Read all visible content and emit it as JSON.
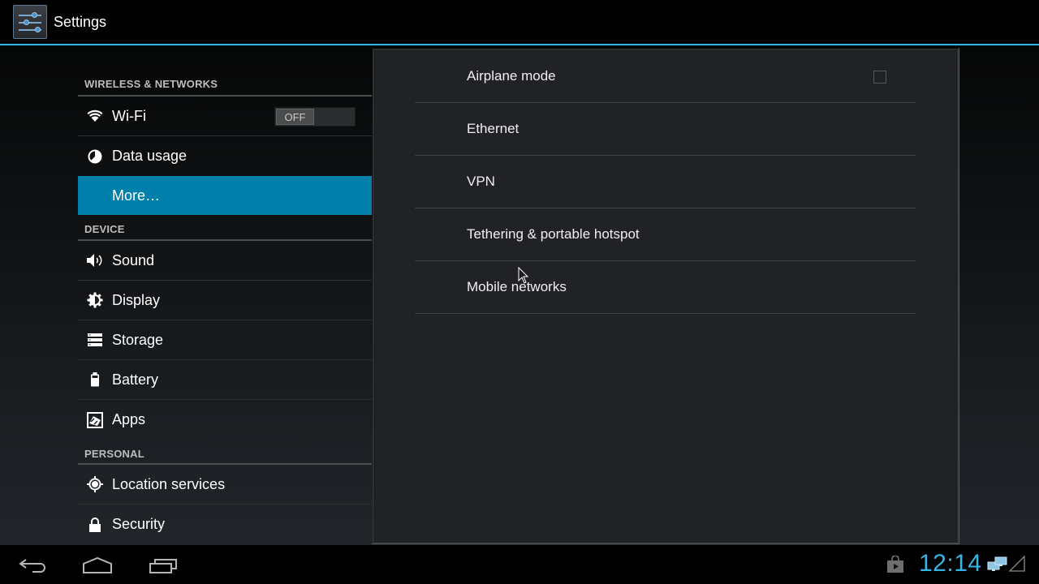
{
  "actionbar": {
    "title": "Settings",
    "app_icon": "settings-sliders-icon"
  },
  "sidebar": {
    "categories": [
      {
        "label": "WIRELESS & NETWORKS",
        "items": [
          {
            "label": "Wi-Fi",
            "icon": "wifi-icon",
            "toggle": "OFF"
          },
          {
            "label": "Data usage",
            "icon": "data-usage-icon"
          },
          {
            "label": "More…",
            "icon": "",
            "selected": true
          }
        ]
      },
      {
        "label": "DEVICE",
        "items": [
          {
            "label": "Sound",
            "icon": "sound-icon"
          },
          {
            "label": "Display",
            "icon": "display-icon"
          },
          {
            "label": "Storage",
            "icon": "storage-icon"
          },
          {
            "label": "Battery",
            "icon": "battery-icon"
          },
          {
            "label": "Apps",
            "icon": "apps-icon"
          }
        ]
      },
      {
        "label": "PERSONAL",
        "items": [
          {
            "label": "Location services",
            "icon": "location-icon"
          },
          {
            "label": "Security",
            "icon": "lock-icon"
          }
        ]
      }
    ]
  },
  "panel": {
    "rows": [
      {
        "label": "Airplane mode",
        "checkbox": false
      },
      {
        "label": "Ethernet"
      },
      {
        "label": "VPN"
      },
      {
        "label": "Tethering & portable hotspot"
      },
      {
        "label": "Mobile networks"
      }
    ]
  },
  "navbar": {
    "buttons": [
      "back-icon",
      "home-icon",
      "recent-apps-icon"
    ],
    "clock": "12:14",
    "status_icons": [
      "play-store-notification-icon",
      "ethernet-connected-icon",
      "signal-empty-icon"
    ]
  },
  "colors": {
    "accent": "#33b5e5",
    "selected": "#0080ab"
  }
}
